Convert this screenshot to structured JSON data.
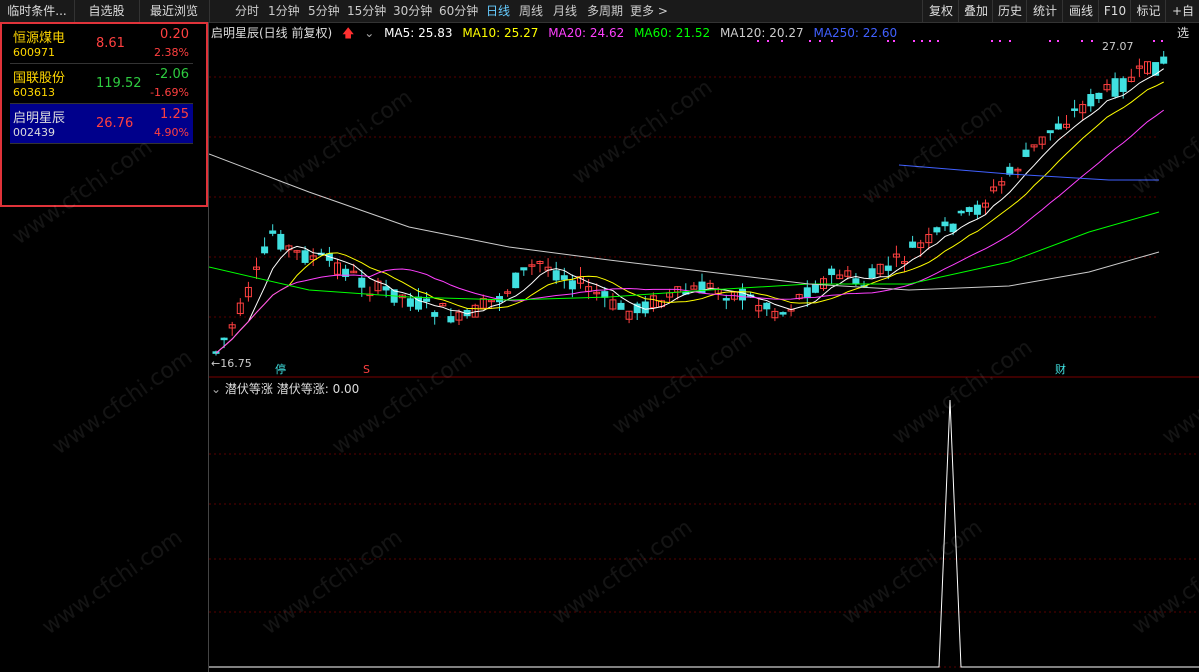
{
  "top_tabs": [
    {
      "label": "临时条件..."
    },
    {
      "label": "自选股"
    },
    {
      "label": "最近浏览"
    }
  ],
  "periods": [
    {
      "label": "分时"
    },
    {
      "label": "1分钟"
    },
    {
      "label": "5分钟"
    },
    {
      "label": "15分钟"
    },
    {
      "label": "30分钟"
    },
    {
      "label": "60分钟"
    },
    {
      "label": "日线",
      "active": true
    },
    {
      "label": "周线"
    },
    {
      "label": "月线"
    },
    {
      "label": "多周期"
    },
    {
      "label": "更多 >"
    }
  ],
  "right_buttons": [
    {
      "label": "复权"
    },
    {
      "label": "叠加"
    },
    {
      "label": "历史"
    },
    {
      "label": "统计"
    },
    {
      "label": "画线"
    },
    {
      "label": "F10"
    },
    {
      "label": "标记"
    },
    {
      "label": "+自选"
    }
  ],
  "stocks": [
    {
      "name": "恒源煤电",
      "code": "600971",
      "price": "8.61",
      "change": "0.20",
      "pct": "2.38%",
      "price_color": "#ff4040",
      "change_color": "#ff4040"
    },
    {
      "name": "国联股份",
      "code": "603613",
      "price": "119.52",
      "change": "-2.06",
      "pct": "-1.69%",
      "price_color": "#2ecc40",
      "change_color": "#2ecc40"
    },
    {
      "name": "启明星辰",
      "code": "002439",
      "price": "26.76",
      "change": "1.25",
      "pct": "4.90%",
      "price_color": "#ff4040",
      "change_color": "#ff4040",
      "selected": true
    }
  ],
  "chart_title": "启明星辰(日线 前复权)",
  "ma": {
    "ma5": "MA5: 25.83",
    "ma10": "MA10: 25.27",
    "ma20": "MA20: 24.62",
    "ma60": "MA60: 21.52",
    "ma120": "MA120: 20.27",
    "ma250": "MA250: 22.60"
  },
  "colors": {
    "ma5": "#ffffff",
    "ma10": "#ffff00",
    "ma20": "#ff40ff",
    "ma60": "#00ff00",
    "ma120": "#cccccc",
    "ma250": "#4060ff",
    "up": "#ff4040",
    "down": "#40e0e0"
  },
  "price_high_label": "27.07",
  "price_low_label": "16.75",
  "markers": {
    "stop": "停",
    "s": "S",
    "cai": "财"
  },
  "sub_title": "潜伏等涨",
  "sub_value": "潜伏等涨: 0.00",
  "watermark": "www.cfchi.com"
}
